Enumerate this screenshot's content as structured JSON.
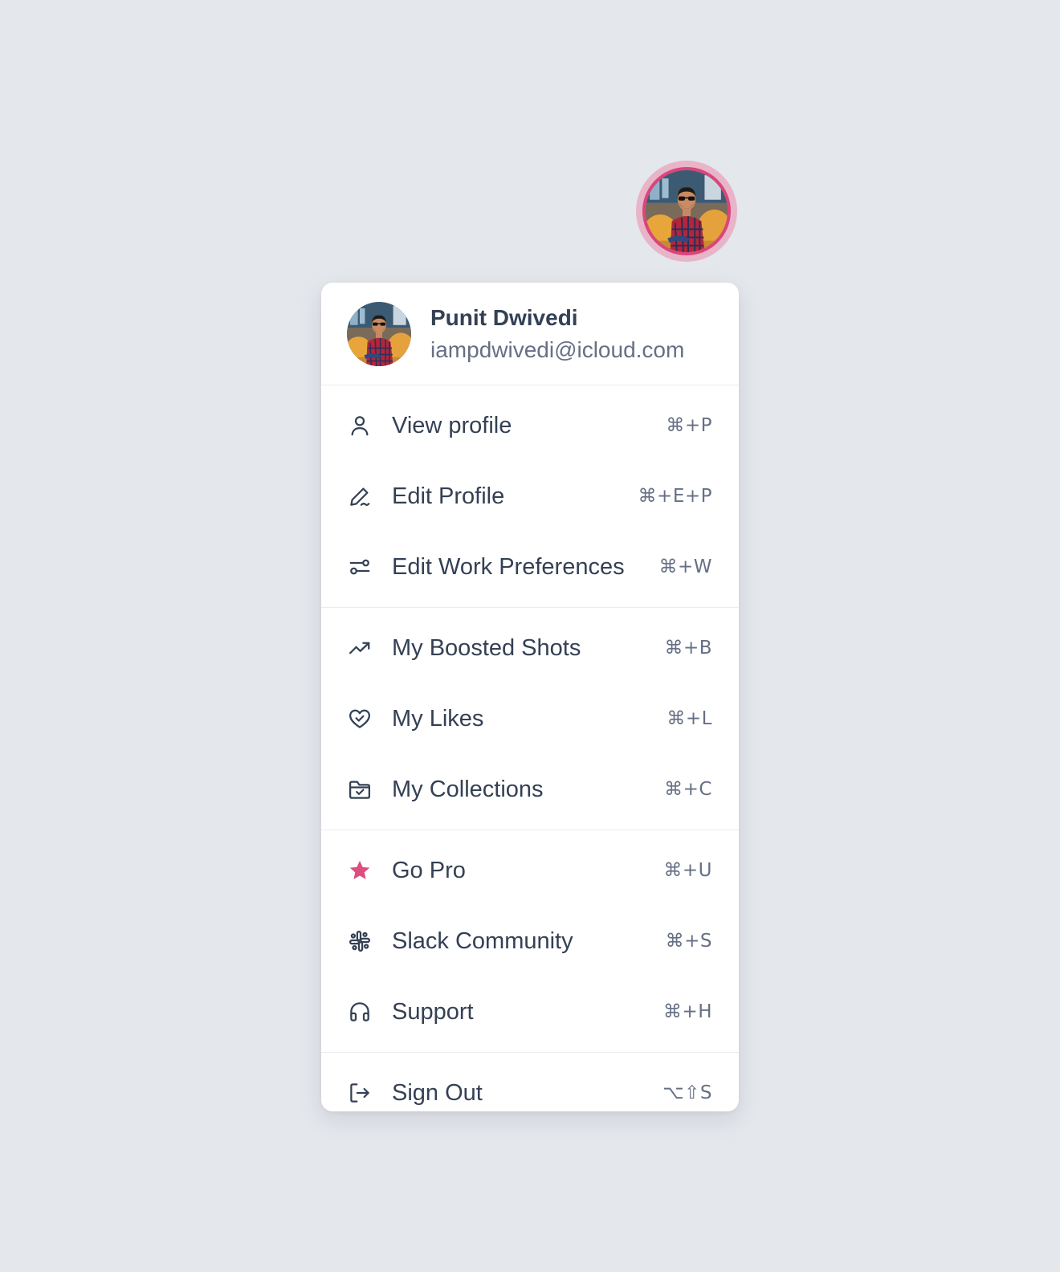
{
  "user": {
    "name": "Punit Dwivedi",
    "email": "iampdwivedi@icloud.com"
  },
  "colors": {
    "accent": "#dd4d7e",
    "background": "#e4e7ec",
    "text": "#344054",
    "muted": "#667085"
  },
  "menu": {
    "groups": [
      {
        "items": [
          {
            "label": "View profile",
            "shortcut": "⌘+P",
            "icon": "user-icon"
          },
          {
            "label": "Edit Profile",
            "shortcut": "⌘+E+P",
            "icon": "pen-icon"
          },
          {
            "label": "Edit Work Preferences",
            "shortcut": "⌘+W",
            "icon": "sliders-icon"
          }
        ]
      },
      {
        "items": [
          {
            "label": "My Boosted Shots",
            "shortcut": "⌘+B",
            "icon": "trending-up-icon"
          },
          {
            "label": "My Likes",
            "shortcut": "⌘+L",
            "icon": "heart-icon"
          },
          {
            "label": "My Collections",
            "shortcut": "⌘+C",
            "icon": "folder-check-icon"
          }
        ]
      },
      {
        "items": [
          {
            "label": "Go Pro",
            "shortcut": "⌘+U",
            "icon": "star-icon"
          },
          {
            "label": "Slack Community",
            "shortcut": "⌘+S",
            "icon": "slack-icon"
          },
          {
            "label": "Support",
            "shortcut": "⌘+H",
            "icon": "headphones-icon"
          }
        ]
      },
      {
        "items": [
          {
            "label": "Sign Out",
            "shortcut": "⌥⇧S",
            "icon": "logout-icon"
          }
        ]
      }
    ]
  }
}
